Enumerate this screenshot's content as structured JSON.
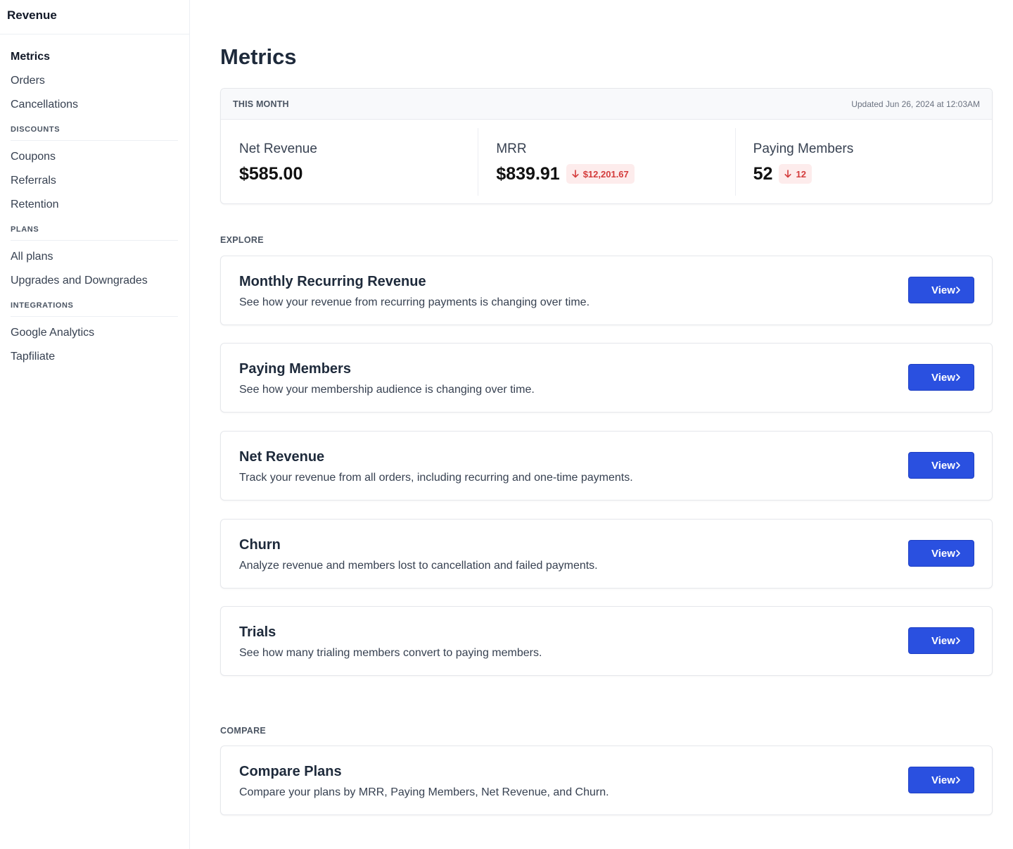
{
  "sidebar": {
    "title": "Revenue",
    "top_items": [
      {
        "label": "Metrics",
        "active": true
      },
      {
        "label": "Orders"
      },
      {
        "label": "Cancellations"
      }
    ],
    "groups": [
      {
        "label": "DISCOUNTS",
        "items": [
          "Coupons",
          "Referrals",
          "Retention"
        ]
      },
      {
        "label": "PLANS",
        "items": [
          "All plans",
          "Upgrades and Downgrades"
        ]
      },
      {
        "label": "INTEGRATIONS",
        "items": [
          "Google Analytics",
          "Tapfiliate"
        ]
      }
    ]
  },
  "main": {
    "title": "Metrics",
    "summary": {
      "label": "THIS MONTH",
      "updated": "Updated Jun 26, 2024 at 12:03AM",
      "metrics": [
        {
          "label": "Net Revenue",
          "value": "$585.00"
        },
        {
          "label": "MRR",
          "value": "$839.91",
          "delta": "$12,201.67",
          "direction": "down"
        },
        {
          "label": "Paying Members",
          "value": "52",
          "delta": "12",
          "direction": "down"
        }
      ]
    },
    "explore_label": "EXPLORE",
    "explore": [
      {
        "title": "Monthly Recurring Revenue",
        "description": "See how your revenue from recurring payments is changing over time.",
        "button": "View"
      },
      {
        "title": "Paying Members",
        "description": "See how your membership audience is changing over time.",
        "button": "View"
      },
      {
        "title": "Net Revenue",
        "description": "Track your revenue from all orders, including recurring and one-time payments.",
        "button": "View"
      },
      {
        "title": "Churn",
        "description": "Analyze revenue and members lost to cancellation and failed payments.",
        "button": "View"
      },
      {
        "title": "Trials",
        "description": "See how many trialing members convert to paying members.",
        "button": "View"
      }
    ],
    "compare_label": "COMPARE",
    "compare": [
      {
        "title": "Compare Plans",
        "description": "Compare your plans by MRR, Paying Members, Net Revenue, and Churn.",
        "button": "View"
      }
    ]
  },
  "colors": {
    "accent": "#2a50e0",
    "negative_text": "#d43b3b",
    "negative_bg": "#fdecec"
  },
  "icons": {
    "delta_down": "arrow-down-icon",
    "view_button": "chevron-right-icon"
  }
}
